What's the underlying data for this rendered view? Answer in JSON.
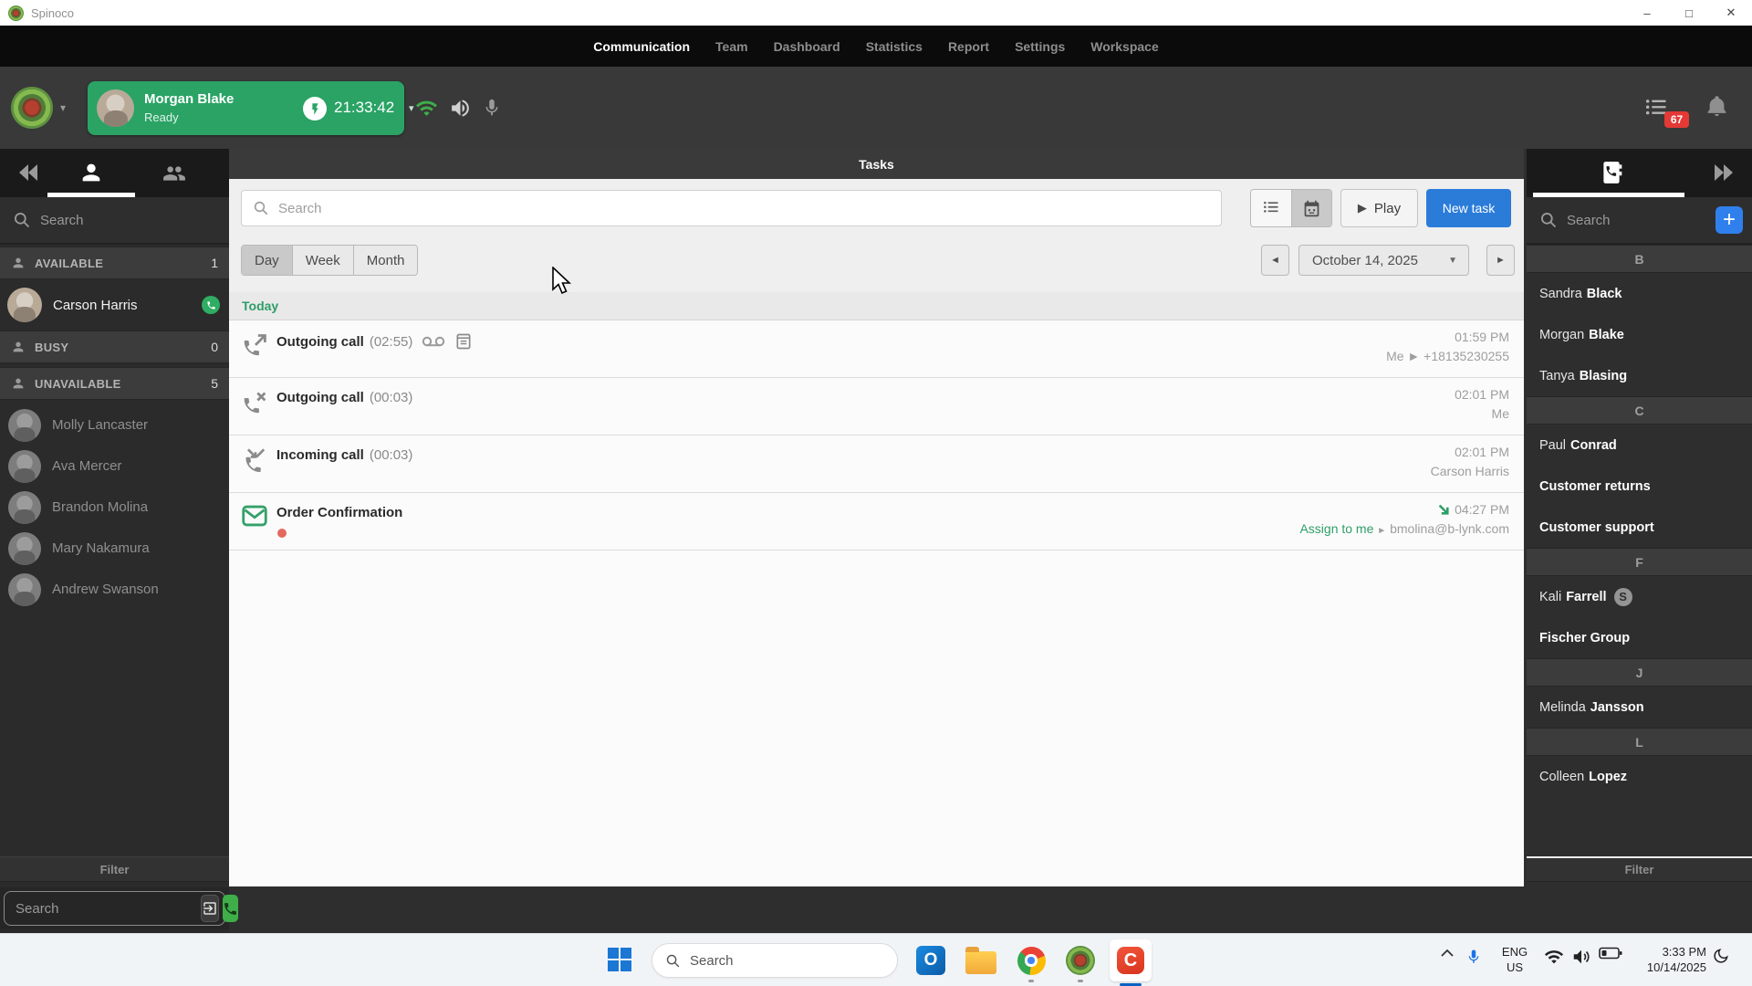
{
  "window": {
    "title": "Spinoco"
  },
  "icons": {
    "minimize": "–",
    "maximize": "□",
    "close": "✕",
    "caret_down": "▾",
    "select_caret": "▼",
    "prev": "◄",
    "next": "►",
    "play": "▶",
    "plus": "+"
  },
  "nav": {
    "items": [
      {
        "label": "Communication",
        "active": true
      },
      {
        "label": "Team"
      },
      {
        "label": "Dashboard"
      },
      {
        "label": "Statistics"
      },
      {
        "label": "Report"
      },
      {
        "label": "Settings"
      },
      {
        "label": "Workspace"
      }
    ]
  },
  "status_bar": {
    "agent_name": "Morgan Blake",
    "agent_status": "Ready",
    "timer": "21:33:42",
    "notification_count": "67"
  },
  "left_sidebar": {
    "search_placeholder": "Search",
    "groups": [
      {
        "label": "AVAILABLE",
        "count": "1"
      },
      {
        "label": "BUSY",
        "count": "0"
      },
      {
        "label": "UNAVAILABLE",
        "count": "5"
      }
    ],
    "available_members": [
      {
        "name": "Carson Harris"
      }
    ],
    "unavailable_members": [
      {
        "name": "Molly Lancaster"
      },
      {
        "name": "Ava Mercer"
      },
      {
        "name": "Brandon Molina"
      },
      {
        "name": "Mary Nakamura"
      },
      {
        "name": "Andrew Swanson"
      }
    ],
    "filter_label": "Filter",
    "dial_search_placeholder": "Search"
  },
  "main": {
    "title": "Tasks",
    "search_placeholder": "Search",
    "play_label": "Play",
    "new_task_label": "New task",
    "view_tabs": [
      {
        "label": "Day",
        "active": true
      },
      {
        "label": "Week"
      },
      {
        "label": "Month"
      }
    ],
    "date_label": "October 14, 2025",
    "section_label": "Today",
    "tasks": [
      {
        "title": "Outgoing call",
        "duration": "(02:55)",
        "time": "01:59 PM",
        "meta": "Me ► +18135230255"
      },
      {
        "title": "Outgoing call",
        "duration": "(00:03)",
        "time": "02:01 PM",
        "meta": "Me"
      },
      {
        "title": "Incoming call",
        "duration": "(00:03)",
        "time": "02:01 PM",
        "meta": "Carson Harris"
      },
      {
        "title": "Order Confirmation",
        "time": "04:27 PM",
        "assign_label": "Assign to me",
        "separator": "►",
        "meta": "bmolina@b-lynk.com"
      }
    ]
  },
  "right_sidebar": {
    "search_placeholder": "Search",
    "sections": [
      {
        "letter": "B",
        "contacts": [
          {
            "first": "Sandra",
            "last": "Black"
          },
          {
            "first": "Morgan",
            "last": "Blake"
          },
          {
            "first": "Tanya",
            "last": "Blasing"
          }
        ]
      },
      {
        "letter": "C",
        "contacts": [
          {
            "first": "Paul",
            "last": "Conrad"
          },
          {
            "first": "",
            "last": "Customer returns"
          },
          {
            "first": "",
            "last": "Customer support"
          }
        ]
      },
      {
        "letter": "F",
        "contacts": [
          {
            "first": "Kali",
            "last": "Farrell",
            "badge": "S"
          },
          {
            "first": "",
            "last": "Fischer Group"
          }
        ]
      },
      {
        "letter": "J",
        "contacts": [
          {
            "first": "Melinda",
            "last": "Jansson"
          }
        ]
      },
      {
        "letter": "L",
        "contacts": [
          {
            "first": "Colleen",
            "last": "Lopez"
          }
        ]
      }
    ],
    "filter_label": "Filter"
  },
  "taskbar": {
    "search_placeholder": "Search",
    "language": "ENG",
    "region": "US",
    "time": "3:33 PM",
    "date": "10/14/2025"
  },
  "colors": {
    "accent_green": "#2aa365",
    "link_green": "#2f9e68",
    "accent_blue": "#2b7cd9",
    "badge_red": "#e53935",
    "unread_dot": "#e4695e",
    "plus_blue": "#2f80ed"
  }
}
